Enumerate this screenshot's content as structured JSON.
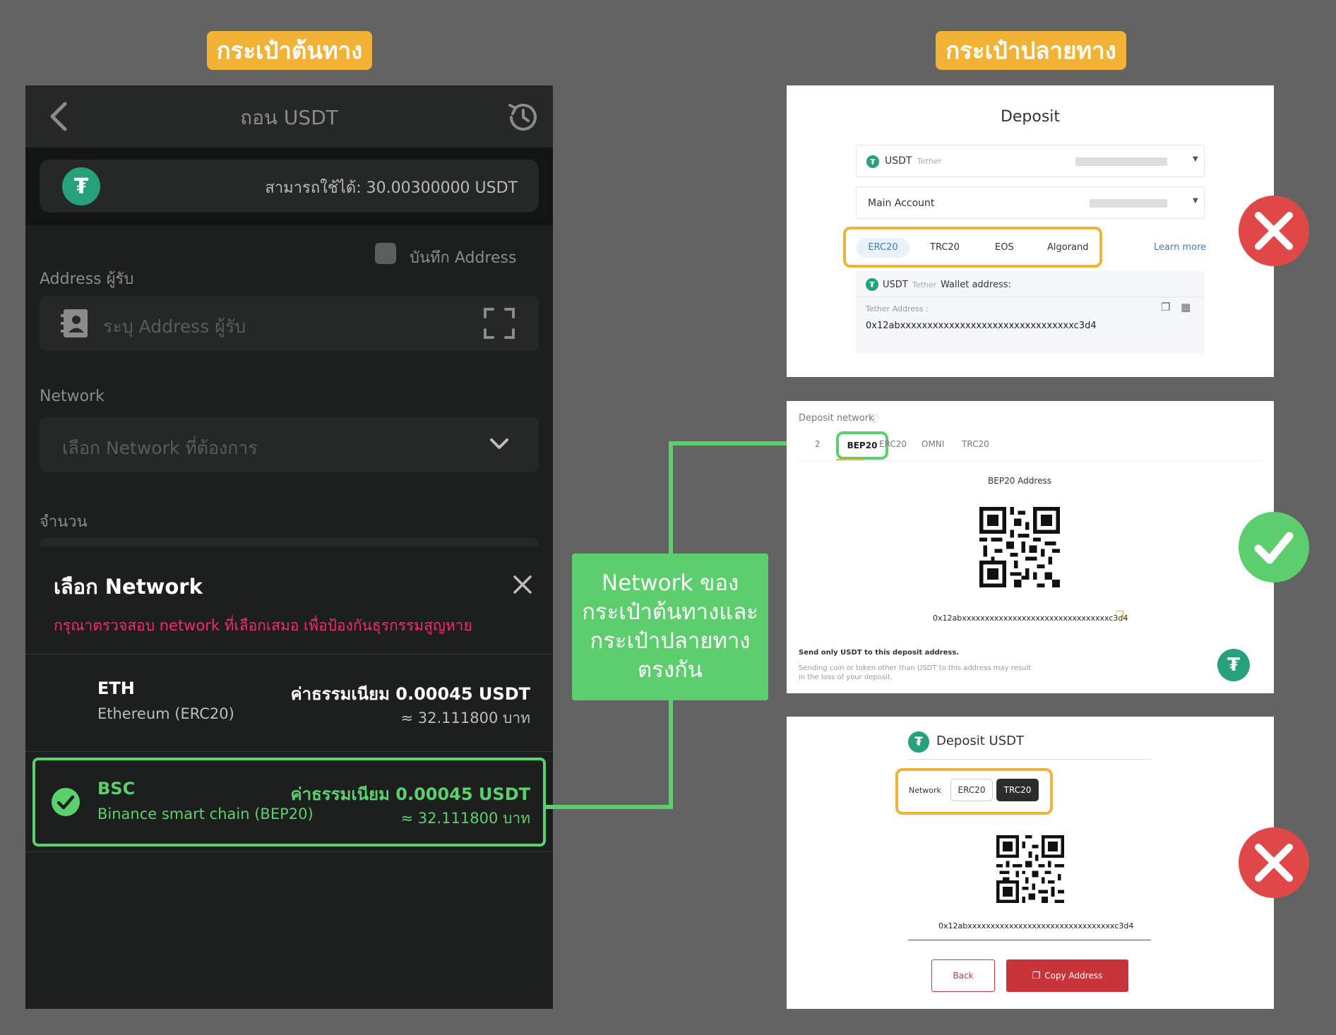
{
  "headers": {
    "source": "กระเป๋าต้นทาง",
    "destination": "กระเป๋าปลายทาง"
  },
  "phone": {
    "title": "ถอน USDT",
    "available": "สามารถใช้ได้: 30.00300000 USDT",
    "save_address": "บันทึก Address",
    "address_label": "Address ผู้รับ",
    "address_placeholder": "ระบุ Address ผู้รับ",
    "network_label": "Network",
    "network_placeholder": "เลือก Network ที่ต้องการ",
    "amount_label": "จำนวน",
    "sheet": {
      "title": "เลือก Network",
      "warning": "กรุณาตรวจสอบ network ที่เลือกเสมอ เพื่อป้องกันธุรกรรมสูญหาย",
      "options": [
        {
          "name": "ETH",
          "sub": "Ethereum (ERC20)",
          "fee": "ค่าธรรมเนียม 0.00045 USDT",
          "thb": "≈ 32.111800 บาท",
          "selected": false
        },
        {
          "name": "BSC",
          "sub": "Binance smart chain (BEP20)",
          "fee": "ค่าธรรมเนียม 0.00045 USDT",
          "thb": "≈ 32.111800 บาท",
          "selected": true
        }
      ]
    }
  },
  "callout": "Network ของ กระเป๋าต้นทางและ กระเป๋าปลายทาง ตรงกัน",
  "panel1": {
    "title": "Deposit",
    "coin": "USDT",
    "coin_sub": "Tether",
    "account": "Main Account",
    "networks": [
      "ERC20",
      "TRC20",
      "EOS",
      "Algorand"
    ],
    "active_network": "ERC20",
    "learn_more": "Learn more",
    "wallet_label_coin": "USDT",
    "wallet_label_sub": "Tether",
    "wallet_label": "Wallet address:",
    "address_label": "Tether Address :",
    "address": "0x12abxxxxxxxxxxxxxxxxxxxxxxxxxxxxxxxxc3d4"
  },
  "panel2": {
    "label": "Deposit network",
    "networks": [
      "2",
      "BEP20",
      "ERC20",
      "OMNI",
      "TRC20"
    ],
    "address_title": "BEP20 Address",
    "address": "0x12abxxxxxxxxxxxxxxxxxxxxxxxxxxxxxxxxc3d4",
    "note_bold": "Send only USDT to this deposit address.",
    "note": "Sending coin or token other than USDT to this address may result in the loss of your deposit."
  },
  "panel3": {
    "title": "Deposit USDT",
    "network_label": "Network",
    "networks": [
      "ERC20",
      "TRC20"
    ],
    "address": "0x12abxxxxxxxxxxxxxxxxxxxxxxxxxxxxxxxxc3d4",
    "back": "Back",
    "copy": "Copy Address"
  },
  "colors": {
    "gold": "#f2b235",
    "green": "#5bd16e",
    "red": "#e04848",
    "tether": "#26a17b",
    "copy_btn": "#c8343a"
  }
}
